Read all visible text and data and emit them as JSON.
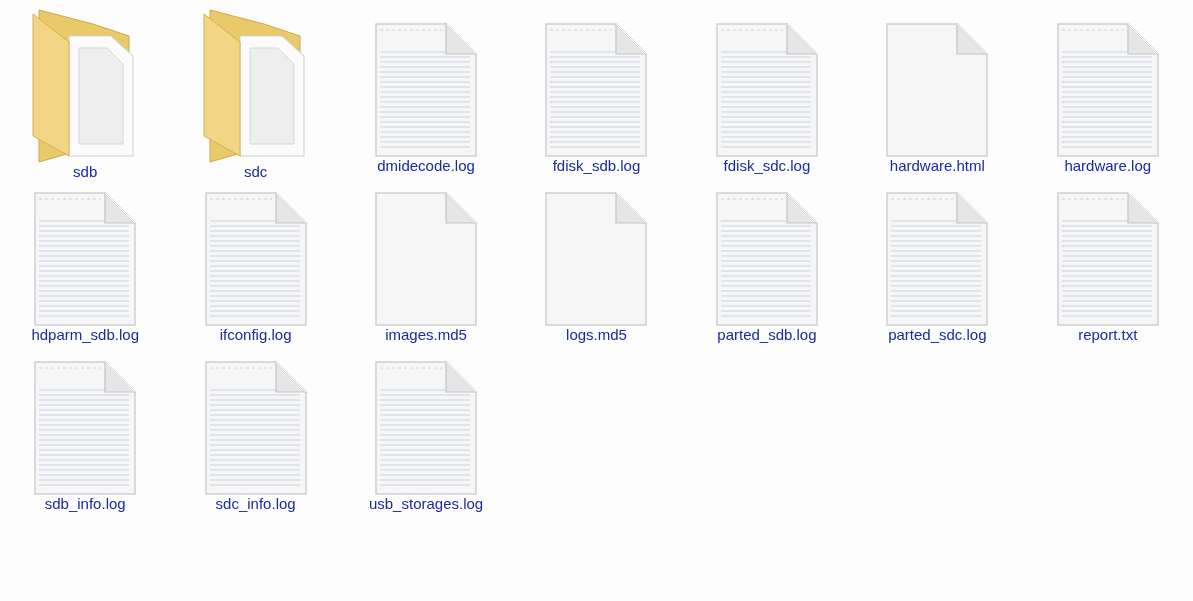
{
  "items": [
    {
      "label": "sdb",
      "kind": "folder"
    },
    {
      "label": "sdc",
      "kind": "folder"
    },
    {
      "label": "dmidecode.log",
      "kind": "text"
    },
    {
      "label": "fdisk_sdb.log",
      "kind": "text"
    },
    {
      "label": "fdisk_sdc.log",
      "kind": "text"
    },
    {
      "label": "hardware.html",
      "kind": "blank"
    },
    {
      "label": "hardware.log",
      "kind": "text"
    },
    {
      "label": "hdparm_sdb.log",
      "kind": "text"
    },
    {
      "label": "ifconfig.log",
      "kind": "text"
    },
    {
      "label": "images.md5",
      "kind": "blank"
    },
    {
      "label": "logs.md5",
      "kind": "blank"
    },
    {
      "label": "parted_sdb.log",
      "kind": "text"
    },
    {
      "label": "parted_sdc.log",
      "kind": "text"
    },
    {
      "label": "report.txt",
      "kind": "text"
    },
    {
      "label": "sdb_info.log",
      "kind": "text"
    },
    {
      "label": "sdc_info.log",
      "kind": "text"
    },
    {
      "label": "usb_storages.log",
      "kind": "text"
    }
  ]
}
